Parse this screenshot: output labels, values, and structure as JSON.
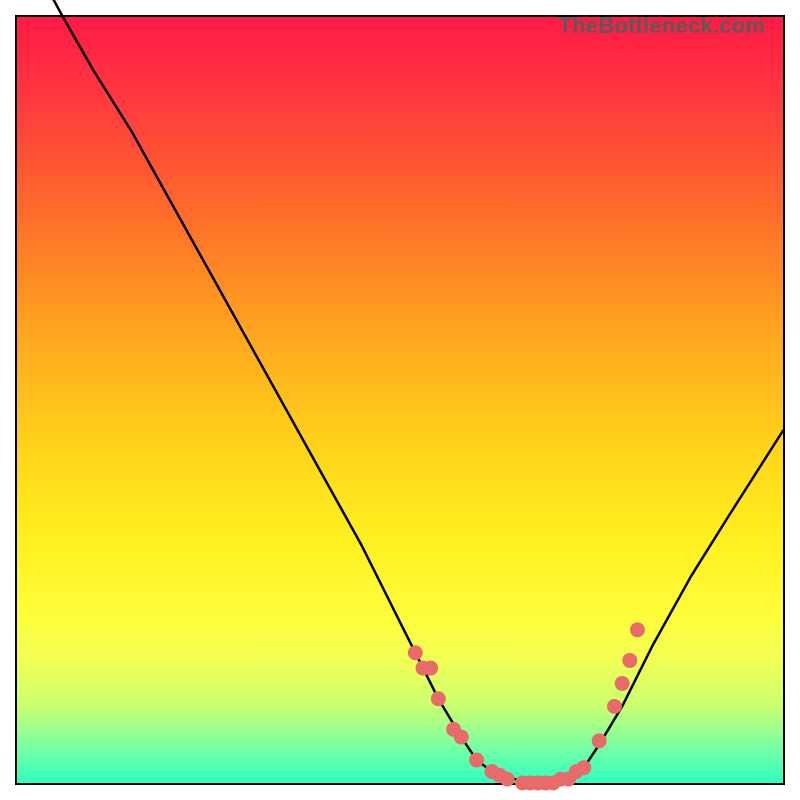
{
  "watermark": "TheBottleneck.com",
  "chart_data": {
    "type": "line",
    "title": "",
    "xlabel": "",
    "ylabel": "",
    "xlim": [
      0,
      100
    ],
    "ylim": [
      0,
      100
    ],
    "grid": false,
    "legend": false,
    "series": [
      {
        "name": "curve",
        "x": [
          0,
          6,
          10,
          15,
          20,
          25,
          30,
          35,
          40,
          45,
          48,
          50,
          53,
          55,
          58,
          60,
          62,
          65,
          67,
          70,
          72,
          74,
          76,
          79,
          83,
          88,
          93,
          100
        ],
        "y": [
          111,
          100,
          93,
          85,
          76,
          67,
          58,
          49,
          40,
          31,
          25,
          21,
          15,
          11,
          6,
          3,
          1.5,
          0.5,
          0,
          0,
          0.5,
          2,
          5,
          10,
          18,
          27,
          35,
          46
        ]
      }
    ],
    "scatter_points": {
      "name": "markers",
      "x": [
        52,
        53,
        54,
        55,
        57,
        58,
        60,
        62,
        63,
        64,
        66,
        67,
        68,
        69,
        70,
        71,
        72,
        73,
        74,
        76,
        78,
        79,
        80,
        81
      ],
      "y": [
        17,
        15,
        15,
        11,
        7,
        6,
        3,
        1.5,
        1,
        0.5,
        0,
        0,
        0,
        0,
        0,
        0.5,
        0.5,
        1.5,
        2,
        5.5,
        10,
        13,
        16,
        20
      ]
    }
  }
}
